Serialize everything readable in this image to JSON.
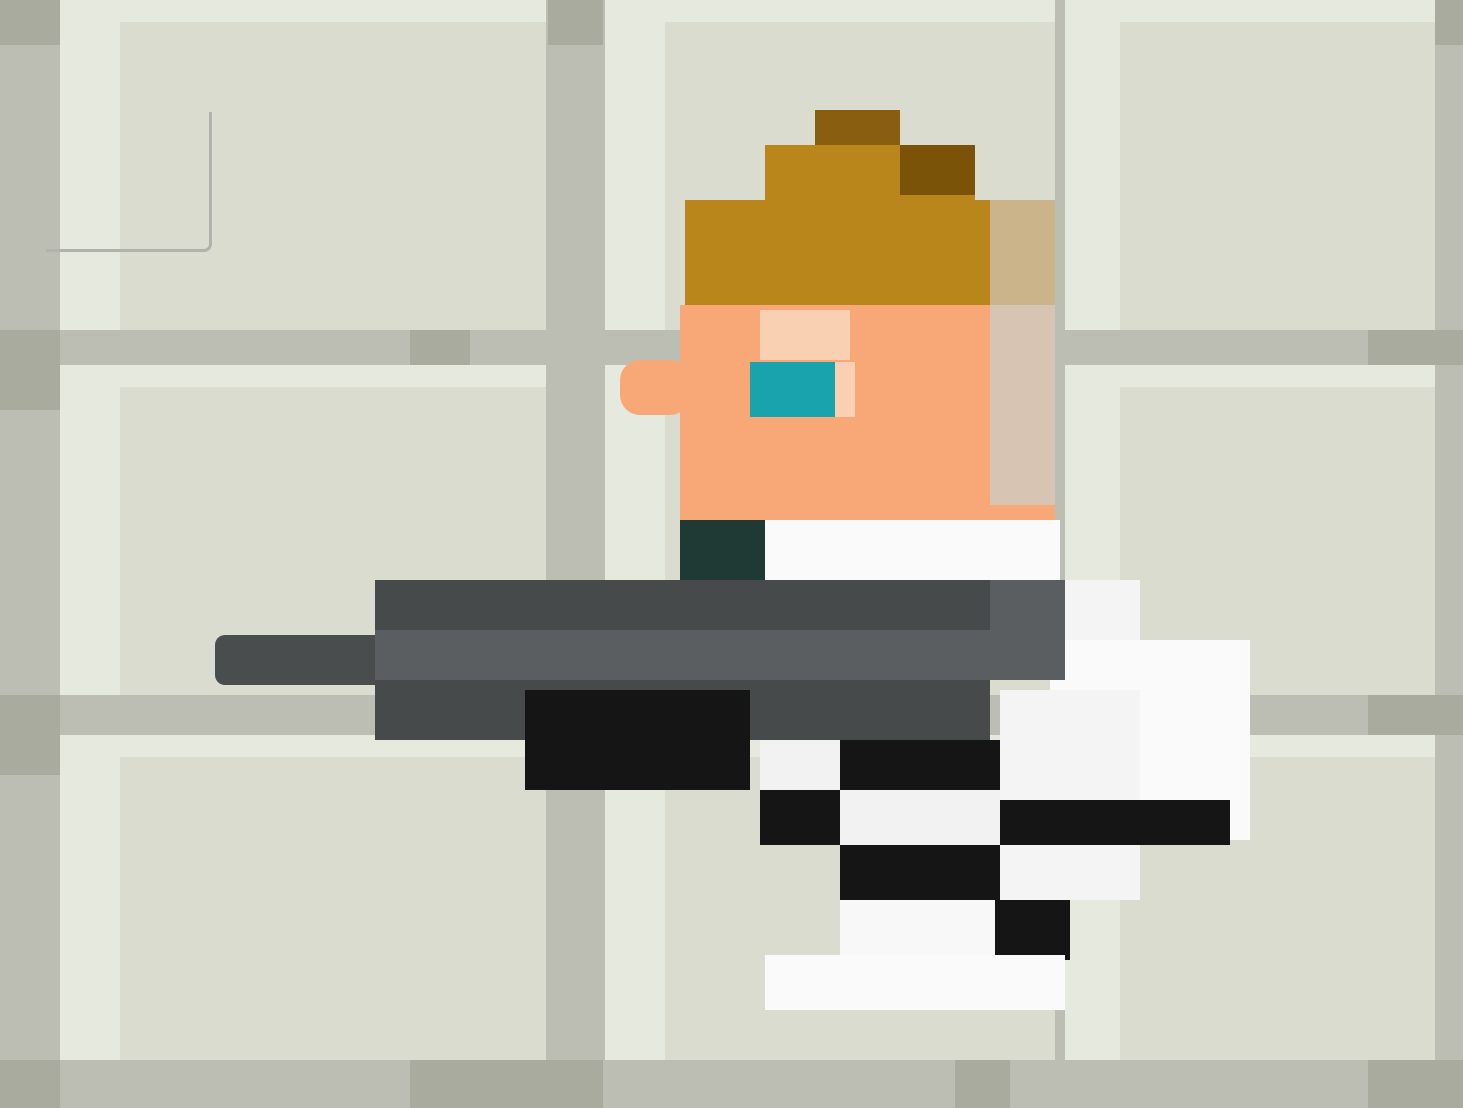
{
  "scene": {
    "type": "pixel-art-game-scene",
    "background": {
      "pattern": "tiled-grid",
      "tile_color": "#dadcd0",
      "tile_highlight_color": "#e6e9de",
      "grid_line_color": "#bcbeb3",
      "grid_joint_color": "#a9ab9f"
    },
    "character": {
      "name": "gunman",
      "facing": "left",
      "colors": {
        "hair": "#b8861a",
        "hair_shadow": "#7a5208",
        "skin": "#f8a876",
        "skin_light": "#fad0b3",
        "eye": "#18a3ad",
        "shirt": "#fafafa",
        "stripe": "#141414",
        "collar": "#1f3a34",
        "gun_dark": "#474a4a",
        "gun_mid": "#5b5e61",
        "gun_black": "#151515"
      }
    },
    "held_item_icon": "submachine-gun-icon",
    "selection_indicator_icon": "corner-bracket-icon"
  }
}
